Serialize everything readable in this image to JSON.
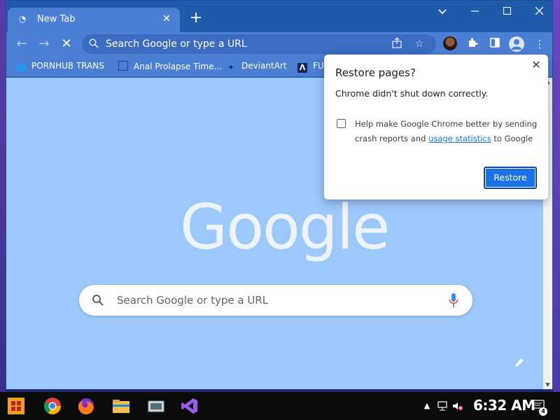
{
  "window": {
    "controls": {
      "minimize": "⌄",
      "restore": "▁",
      "maximize": "□",
      "close": "✕"
    }
  },
  "tab": {
    "title": "New Tab",
    "close": "✕",
    "new_tab": "+"
  },
  "toolbar": {
    "back": "←",
    "forward": "→",
    "stop": "✕",
    "omnibox_placeholder": "Search Google or type a URL"
  },
  "bookmarks": [
    {
      "label": "PORNHUB TRANS",
      "icon": "globe-icon"
    },
    {
      "label": "Anal Prolapse Time...",
      "icon": "page-icon"
    },
    {
      "label": "DeviantArt",
      "icon": "deviantart-icon"
    },
    {
      "label": "FU",
      "icon": "arrow-logo-icon"
    }
  ],
  "ntp": {
    "logo": "Google",
    "search_placeholder": "Search Google or type a URL"
  },
  "dialog": {
    "title": "Restore pages?",
    "message": "Chrome didn't shut down correctly.",
    "help_prefix": "Help make Google Chrome better by sending crash reports and ",
    "help_link": "usage statistics",
    "help_suffix": " to Google",
    "close": "✕",
    "restore_label": "Restore"
  },
  "taskbar": {
    "clock": "6:32 AM",
    "notification_count": "4"
  },
  "colors": {
    "titlebar": "#1f5aab",
    "toolbar": "#4a7fd4",
    "content": "#9cc8fc",
    "accent": "#1a73e8"
  }
}
